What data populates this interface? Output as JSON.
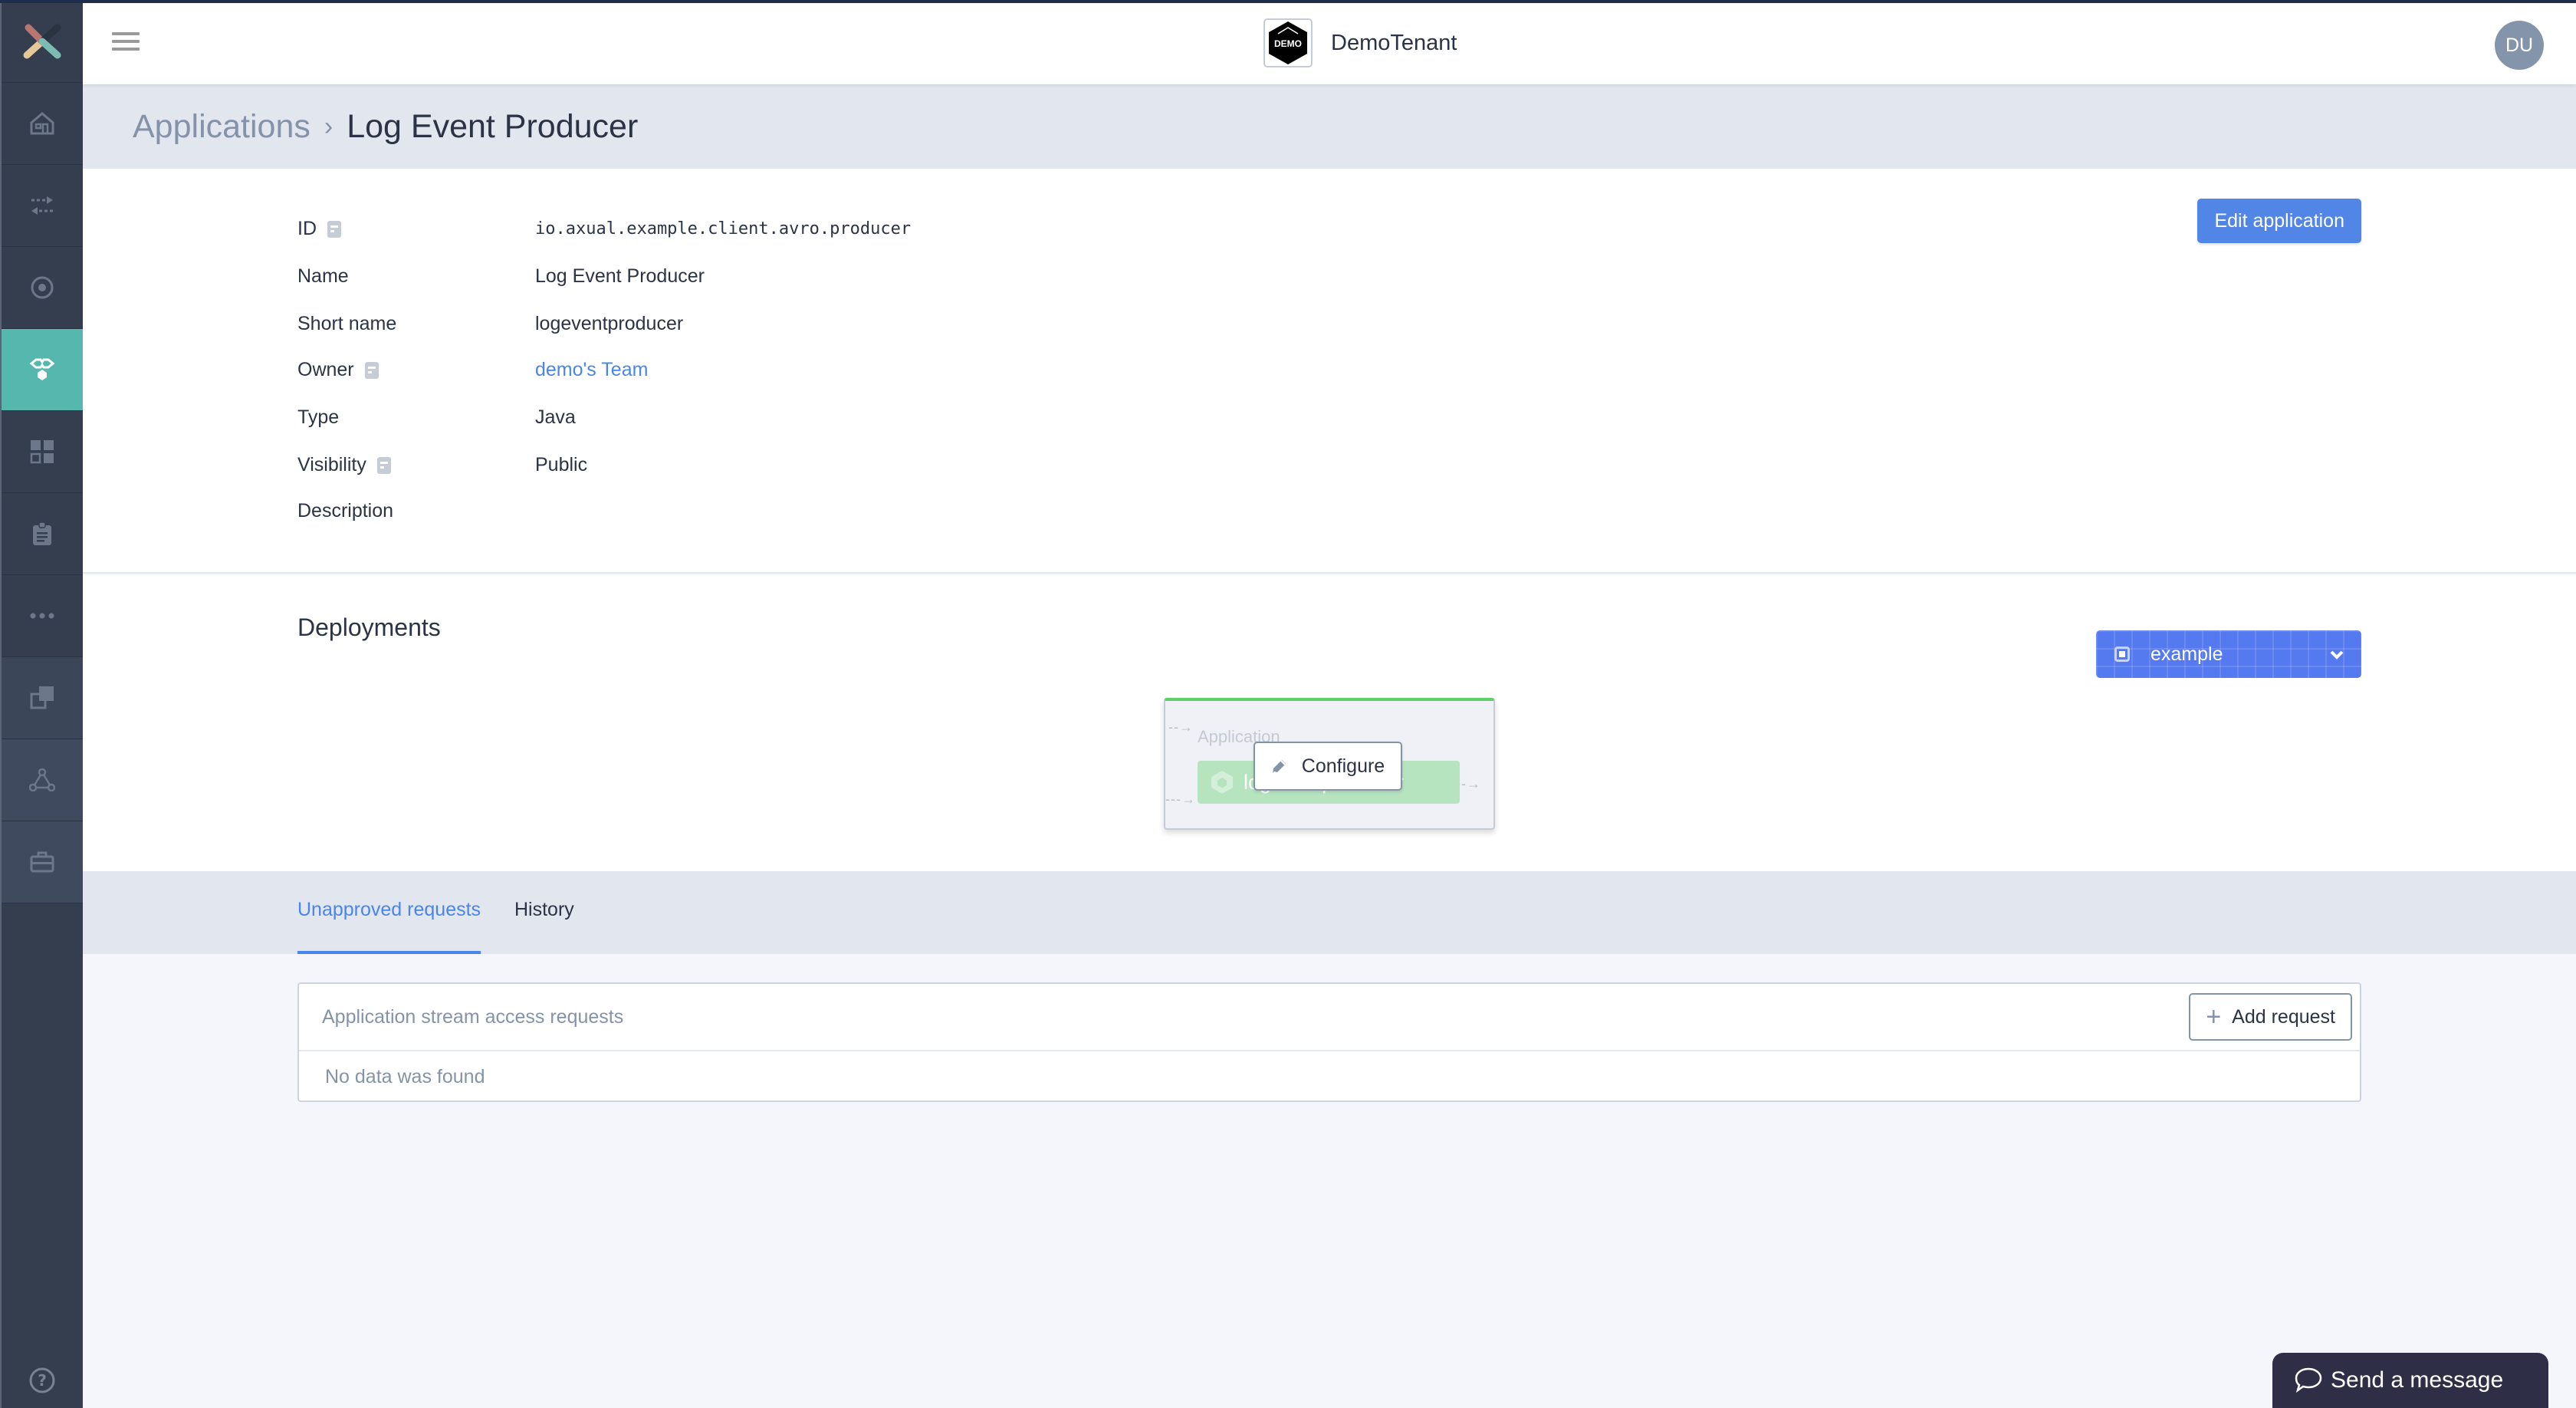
{
  "header": {
    "tenant_logo_text": "DEMO",
    "tenant_name": "DemoTenant",
    "user_initials": "DU"
  },
  "sidebar": {
    "items": [
      {
        "icon": "home-icon",
        "active": false
      },
      {
        "icon": "streams-icon",
        "active": false
      },
      {
        "icon": "environment-icon",
        "active": false
      },
      {
        "icon": "applications-icon",
        "active": true
      },
      {
        "icon": "dashboard-icon",
        "active": false
      },
      {
        "icon": "clipboard-icon",
        "active": false
      },
      {
        "icon": "more-icon",
        "active": false
      },
      {
        "icon": "copy-icon",
        "active": false
      },
      {
        "icon": "network-icon",
        "active": false
      },
      {
        "icon": "toolbox-icon",
        "active": false
      }
    ],
    "help_icon": "help-icon"
  },
  "breadcrumb": {
    "parent": "Applications",
    "separator": "›",
    "current": "Log Event Producer"
  },
  "details": {
    "edit_button": "Edit application",
    "fields": [
      {
        "label": "ID",
        "value": "io.axual.example.client.avro.producer",
        "info": true
      },
      {
        "label": "Name",
        "value": "Log Event Producer",
        "info": false
      },
      {
        "label": "Short name",
        "value": "logeventproducer",
        "info": false
      },
      {
        "label": "Owner",
        "value": "demo's Team",
        "info": true
      },
      {
        "label": "Type",
        "value": "Java",
        "info": false
      },
      {
        "label": "Visibility",
        "value": "Public",
        "info": true
      },
      {
        "label": "Description",
        "value": "",
        "info": false
      }
    ]
  },
  "deployments": {
    "title": "Deployments",
    "environment": "example",
    "node": {
      "type": "Application",
      "name": "logeventproducer"
    },
    "configure_button": "Configure",
    "colors": {
      "status": "#5ed06b",
      "environment": "#5579ef"
    }
  },
  "tabs": [
    {
      "label": "Unapproved requests",
      "active": true
    },
    {
      "label": "History",
      "active": false
    }
  ],
  "requests": {
    "title": "Application stream access requests",
    "add_button": "Add request",
    "empty_text": "No data was found"
  },
  "chat": {
    "label": "Send a message"
  },
  "colors": {
    "accent": "#5185e6",
    "sidebar_active": "#56b7ae",
    "sidebar_bg": "#343e4f"
  }
}
